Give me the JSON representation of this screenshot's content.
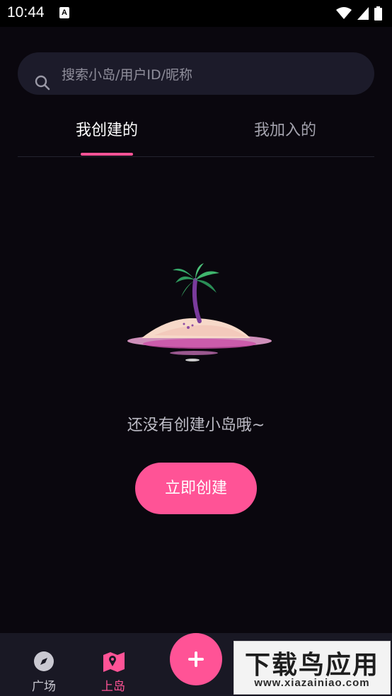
{
  "status_bar": {
    "time": "10:44",
    "notification_icon": "a-box-icon",
    "right_icons": [
      "wifi-icon",
      "cellular-signal-icon",
      "battery-icon"
    ]
  },
  "search": {
    "placeholder": "搜索小岛/用户ID/昵称"
  },
  "tabs": [
    {
      "label": "我创建的",
      "active": true
    },
    {
      "label": "我加入的",
      "active": false
    }
  ],
  "empty_state": {
    "illustration": "palm-island-illustration",
    "message": "还没有创建小岛哦~",
    "button_label": "立即创建"
  },
  "bottom_nav": {
    "items": [
      {
        "label": "广场",
        "icon": "compass-icon",
        "active": false
      },
      {
        "label": "上岛",
        "icon": "map-icon",
        "active": true
      }
    ],
    "fab_icon": "plus-icon"
  },
  "watermark": {
    "title": "下载鸟应用",
    "url": "www.xiazainiao.com"
  },
  "colors": {
    "accent": "#ff5396",
    "background": "#0a070e",
    "search_bg": "#1c1b2a",
    "nav_bg": "#191824"
  }
}
